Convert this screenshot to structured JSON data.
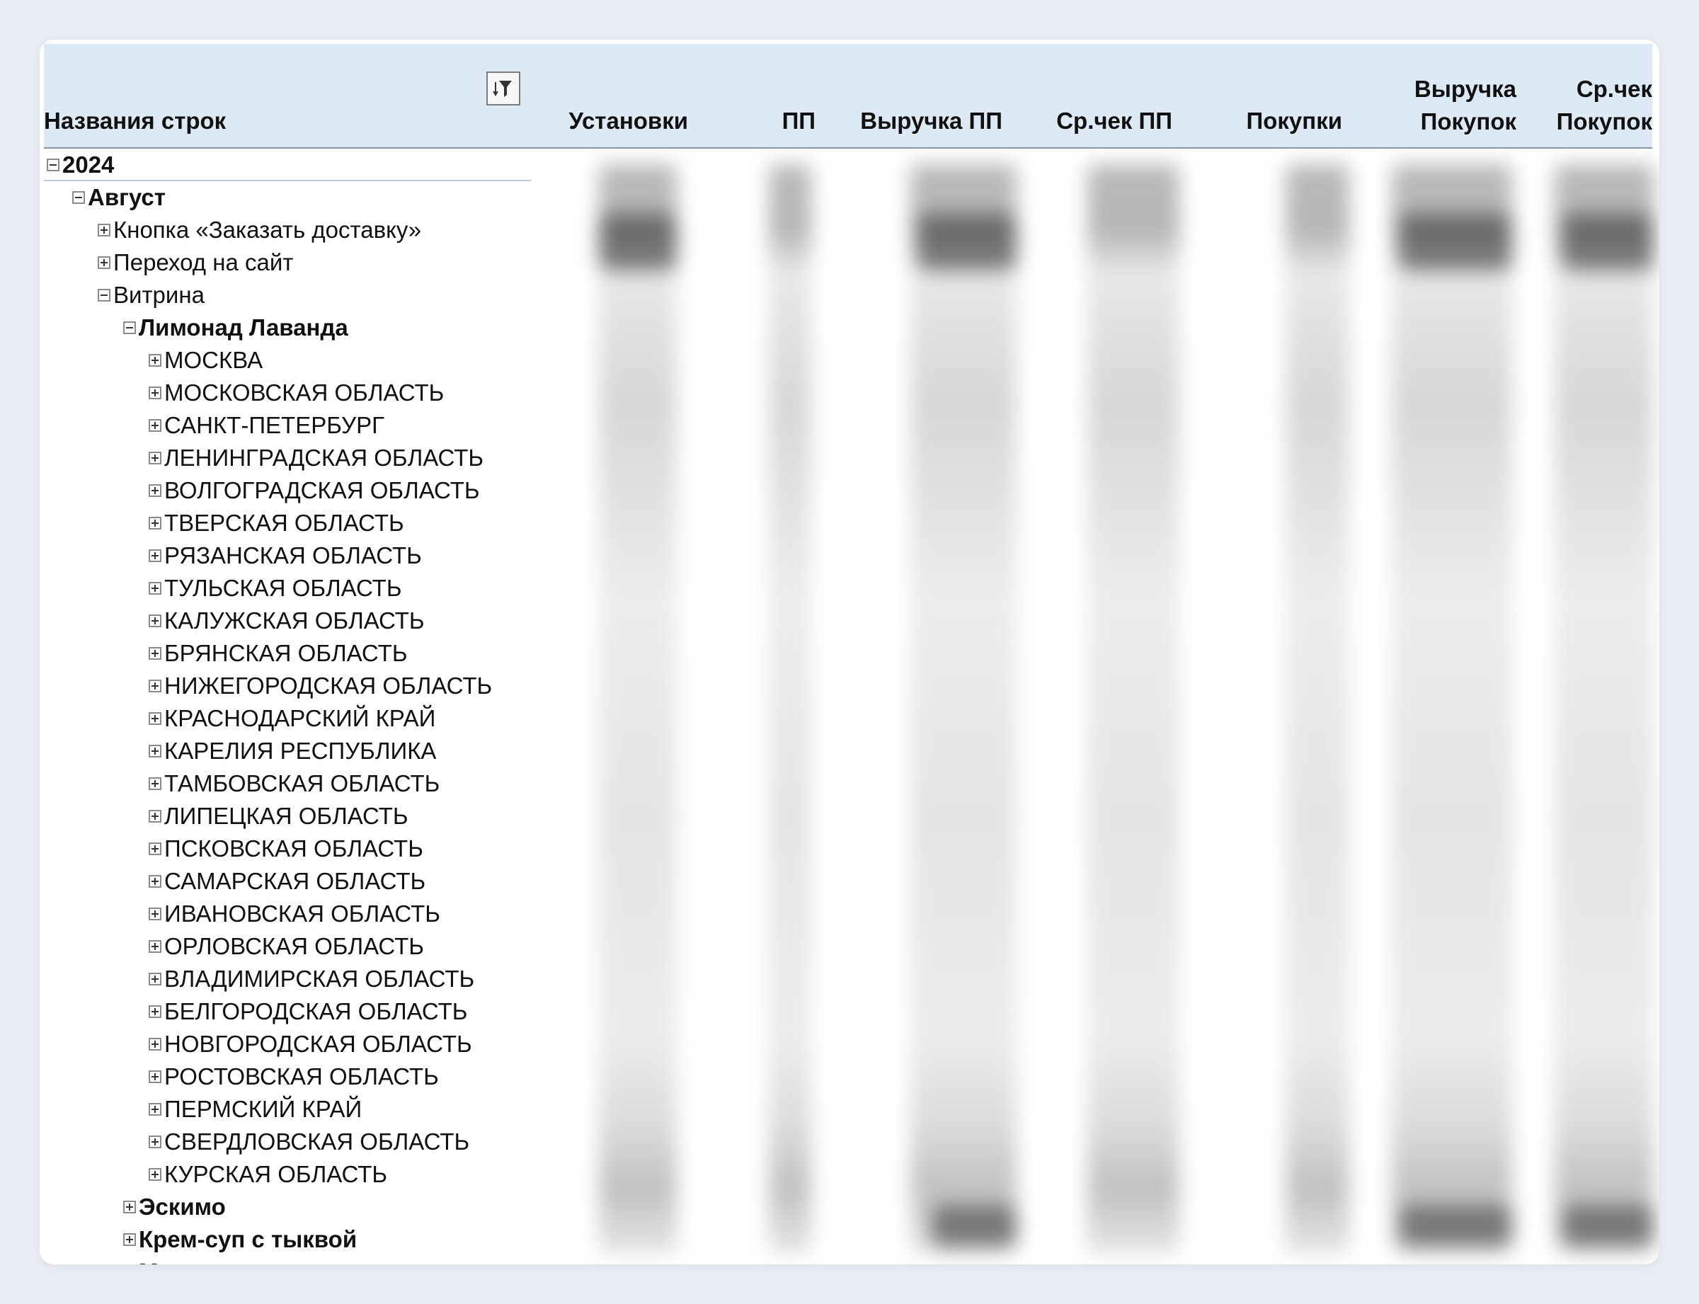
{
  "pivot": {
    "header": {
      "row_labels": "Названия строк",
      "columns": [
        {
          "line1": "",
          "line2": "Установки"
        },
        {
          "line1": "",
          "line2": "ПП"
        },
        {
          "line1": "",
          "line2": "Выручка ПП"
        },
        {
          "line1": "",
          "line2": "Ср.чек ПП"
        },
        {
          "line1": "",
          "line2": "Покупки"
        },
        {
          "line1": "Выручка",
          "line2": "Покупок"
        },
        {
          "line1": "Ср.чек",
          "line2": "Покупок"
        }
      ],
      "filter_icon": "filter-sort-icon"
    },
    "rows": [
      {
        "label": "2024",
        "level": 0,
        "toggle": "minus",
        "bold": true
      },
      {
        "label": "Август",
        "level": 1,
        "toggle": "minus",
        "bold": true
      },
      {
        "label": "Кнопка «Заказать доставку»",
        "level": 2,
        "toggle": "plus",
        "bold": false
      },
      {
        "label": "Переход на сайт",
        "level": 2,
        "toggle": "plus",
        "bold": false
      },
      {
        "label": "Витрина",
        "level": 2,
        "toggle": "minus",
        "bold": false
      },
      {
        "label": "Лимонад Лаванда",
        "level": 3,
        "toggle": "minus",
        "bold": true
      },
      {
        "label": "МОСКВА",
        "level": 4,
        "toggle": "plus",
        "bold": false
      },
      {
        "label": "МОСКОВСКАЯ ОБЛАСТЬ",
        "level": 4,
        "toggle": "plus",
        "bold": false
      },
      {
        "label": "САНКТ-ПЕТЕРБУРГ",
        "level": 4,
        "toggle": "plus",
        "bold": false
      },
      {
        "label": "ЛЕНИНГРАДСКАЯ ОБЛАСТЬ",
        "level": 4,
        "toggle": "plus",
        "bold": false
      },
      {
        "label": "ВОЛГОГРАДСКАЯ ОБЛАСТЬ",
        "level": 4,
        "toggle": "plus",
        "bold": false
      },
      {
        "label": "ТВЕРСКАЯ ОБЛАСТЬ",
        "level": 4,
        "toggle": "plus",
        "bold": false
      },
      {
        "label": "РЯЗАНСКАЯ ОБЛАСТЬ",
        "level": 4,
        "toggle": "plus",
        "bold": false
      },
      {
        "label": "ТУЛЬСКАЯ ОБЛАСТЬ",
        "level": 4,
        "toggle": "plus",
        "bold": false
      },
      {
        "label": "КАЛУЖСКАЯ ОБЛАСТЬ",
        "level": 4,
        "toggle": "plus",
        "bold": false
      },
      {
        "label": "БРЯНСКАЯ ОБЛАСТЬ",
        "level": 4,
        "toggle": "plus",
        "bold": false
      },
      {
        "label": "НИЖЕГОРОДСКАЯ ОБЛАСТЬ",
        "level": 4,
        "toggle": "plus",
        "bold": false
      },
      {
        "label": "КРАСНОДАРСКИЙ КРАЙ",
        "level": 4,
        "toggle": "plus",
        "bold": false
      },
      {
        "label": "КАРЕЛИЯ РЕСПУБЛИКА",
        "level": 4,
        "toggle": "plus",
        "bold": false
      },
      {
        "label": "ТАМБОВСКАЯ ОБЛАСТЬ",
        "level": 4,
        "toggle": "plus",
        "bold": false
      },
      {
        "label": "ЛИПЕЦКАЯ ОБЛАСТЬ",
        "level": 4,
        "toggle": "plus",
        "bold": false
      },
      {
        "label": "ПСКОВСКАЯ ОБЛАСТЬ",
        "level": 4,
        "toggle": "plus",
        "bold": false
      },
      {
        "label": "САМАРСКАЯ ОБЛАСТЬ",
        "level": 4,
        "toggle": "plus",
        "bold": false
      },
      {
        "label": "ИВАНОВСКАЯ ОБЛАСТЬ",
        "level": 4,
        "toggle": "plus",
        "bold": false
      },
      {
        "label": "ОРЛОВСКАЯ ОБЛАСТЬ",
        "level": 4,
        "toggle": "plus",
        "bold": false
      },
      {
        "label": "ВЛАДИМИРСКАЯ ОБЛАСТЬ",
        "level": 4,
        "toggle": "plus",
        "bold": false
      },
      {
        "label": "БЕЛГОРОДСКАЯ ОБЛАСТЬ",
        "level": 4,
        "toggle": "plus",
        "bold": false
      },
      {
        "label": "НОВГОРОДСКАЯ ОБЛАСТЬ",
        "level": 4,
        "toggle": "plus",
        "bold": false
      },
      {
        "label": "РОСТОВСКАЯ ОБЛАСТЬ",
        "level": 4,
        "toggle": "plus",
        "bold": false
      },
      {
        "label": "ПЕРМСКИЙ КРАЙ",
        "level": 4,
        "toggle": "plus",
        "bold": false
      },
      {
        "label": "СВЕРДЛОВСКАЯ ОБЛАСТЬ",
        "level": 4,
        "toggle": "plus",
        "bold": false
      },
      {
        "label": "КУРСКАЯ ОБЛАСТЬ",
        "level": 4,
        "toggle": "plus",
        "bold": false
      },
      {
        "label": "Эскимо",
        "level": 3,
        "toggle": "plus",
        "bold": true
      },
      {
        "label": "Крем-суп с тыквой",
        "level": 3,
        "toggle": "plus",
        "bold": true
      },
      {
        "label": "Мороженое с маршмеллоу",
        "level": 3,
        "toggle": "plus",
        "bold": true
      }
    ]
  },
  "colors": {
    "page_background": "#e9ecf2",
    "header_background": "#dde9f5",
    "card_background": "#ffffff"
  }
}
